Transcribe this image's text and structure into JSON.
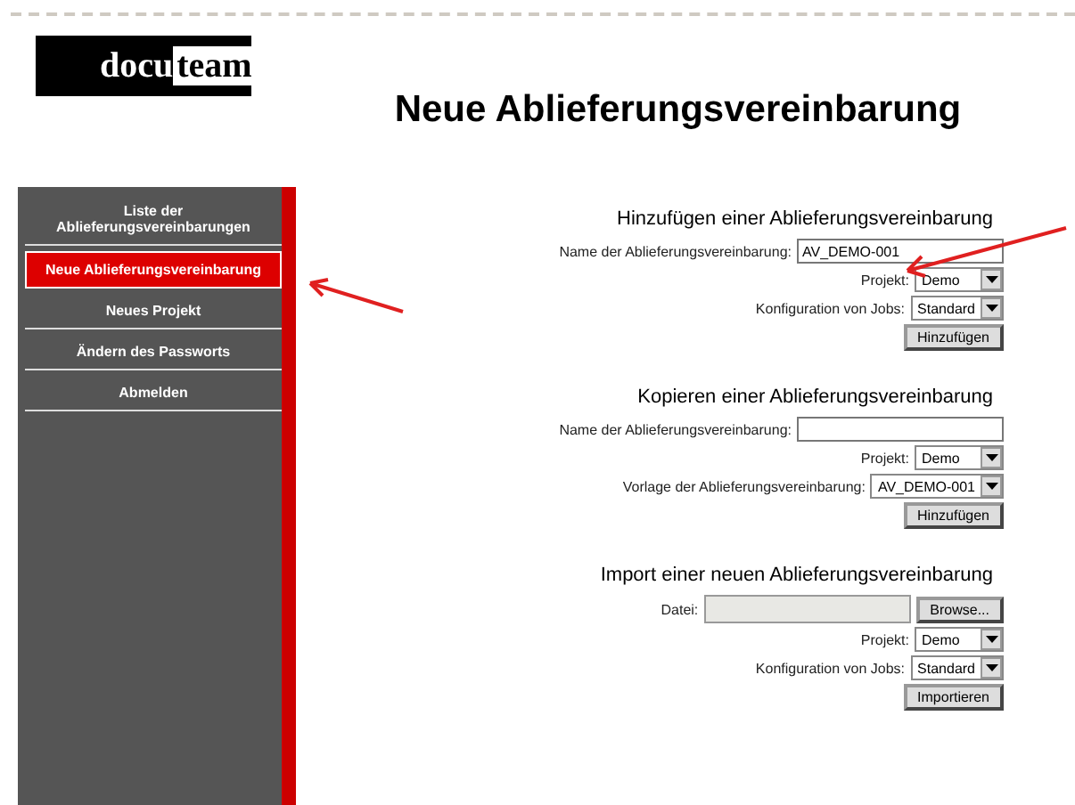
{
  "logo": {
    "dark_part": "docu",
    "light_part": "team"
  },
  "title": "Neue Ablieferungsvereinbarung",
  "sidebar": {
    "items": [
      {
        "label": "Liste der Ablieferungsvereinbarungen",
        "selected": false
      },
      {
        "label": "Neue Ablieferungsvereinbarung",
        "selected": true
      },
      {
        "label": "Neues Projekt",
        "selected": false
      },
      {
        "label": "Ändern des Passworts",
        "selected": false
      },
      {
        "label": "Abmelden",
        "selected": false
      }
    ]
  },
  "sections": [
    {
      "heading": "Hinzufügen einer Ablieferungsvereinbarung",
      "fields": [
        {
          "kind": "text",
          "label": "Name der Ablieferungsvereinbarung:",
          "value": "AV_DEMO-001"
        },
        {
          "kind": "select",
          "label": "Projekt:",
          "value": "Demo"
        },
        {
          "kind": "select",
          "label": "Konfiguration von Jobs:",
          "value": "Standard"
        }
      ],
      "button": "Hinzufügen"
    },
    {
      "heading": "Kopieren einer Ablieferungsvereinbarung",
      "fields": [
        {
          "kind": "text",
          "label": "Name der Ablieferungsvereinbarung:"
        },
        {
          "kind": "select",
          "label": "Projekt:",
          "value": "Demo"
        },
        {
          "kind": "select",
          "label": "Vorlage der Ablieferungsvereinbarung:",
          "value": "AV_DEMO-001"
        }
      ],
      "button": "Hinzufügen"
    },
    {
      "heading": "Import einer neuen Ablieferungsvereinbarung",
      "fields": [
        {
          "kind": "file",
          "label": "Datei:",
          "browse": "Browse..."
        },
        {
          "kind": "select",
          "label": "Projekt:",
          "value": "Demo"
        },
        {
          "kind": "select",
          "label": "Konfiguration von Jobs:",
          "value": "Standard"
        }
      ],
      "button": "Importieren"
    }
  ]
}
